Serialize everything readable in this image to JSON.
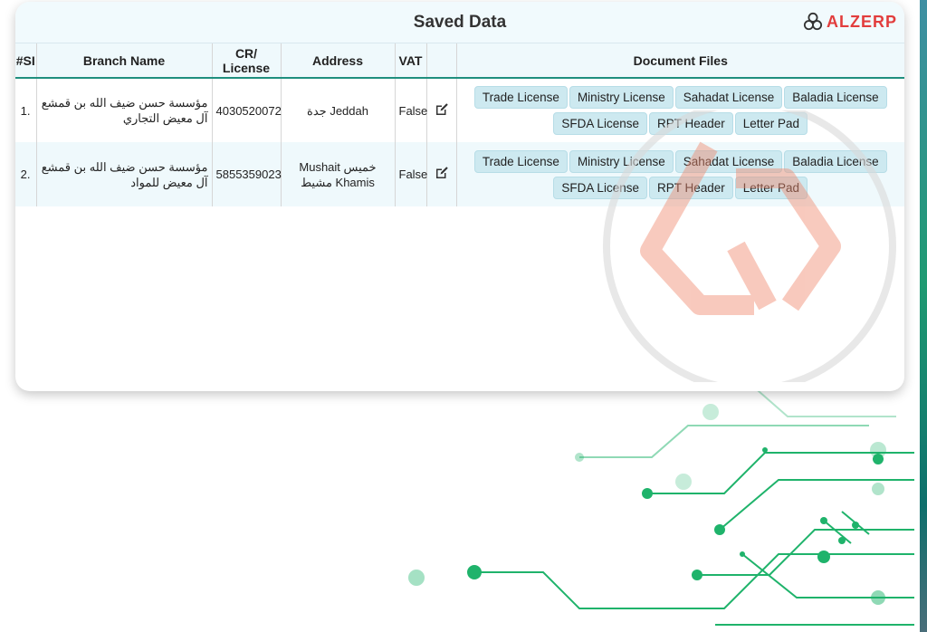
{
  "panel": {
    "title": "Saved Data",
    "brand": "ALZERP"
  },
  "table": {
    "headers": [
      "#SI",
      "Branch Name",
      "CR/ License",
      "Address",
      "VAT",
      "",
      "Document Files"
    ],
    "rows": [
      {
        "num": "1.",
        "branch": "مؤسسة حسن ضيف الله بن قمشع آل معيض التجاري",
        "cr": "4030520072",
        "address": "جدة Jeddah",
        "vat": "False"
      },
      {
        "num": "2.",
        "branch": "مؤسسة حسن ضيف الله بن قمشع آل معيض للمواد",
        "cr": "5855359023",
        "address": "Mushait خميس مشيط Khamis",
        "vat": "False"
      }
    ],
    "doc_buttons": [
      "Trade License",
      "Ministry License",
      "Sahadat License",
      "Baladia License",
      "SFDA License",
      "RPT Header",
      "Letter Pad"
    ]
  },
  "colors": {
    "accent": "#1f8f7e",
    "button_bg": "#cde9f0",
    "header_bg": "#f1fafd",
    "brand": "#e23d3d"
  },
  "icons": {
    "brand": "alzerp-logo-icon",
    "edit": "edit-icon"
  }
}
